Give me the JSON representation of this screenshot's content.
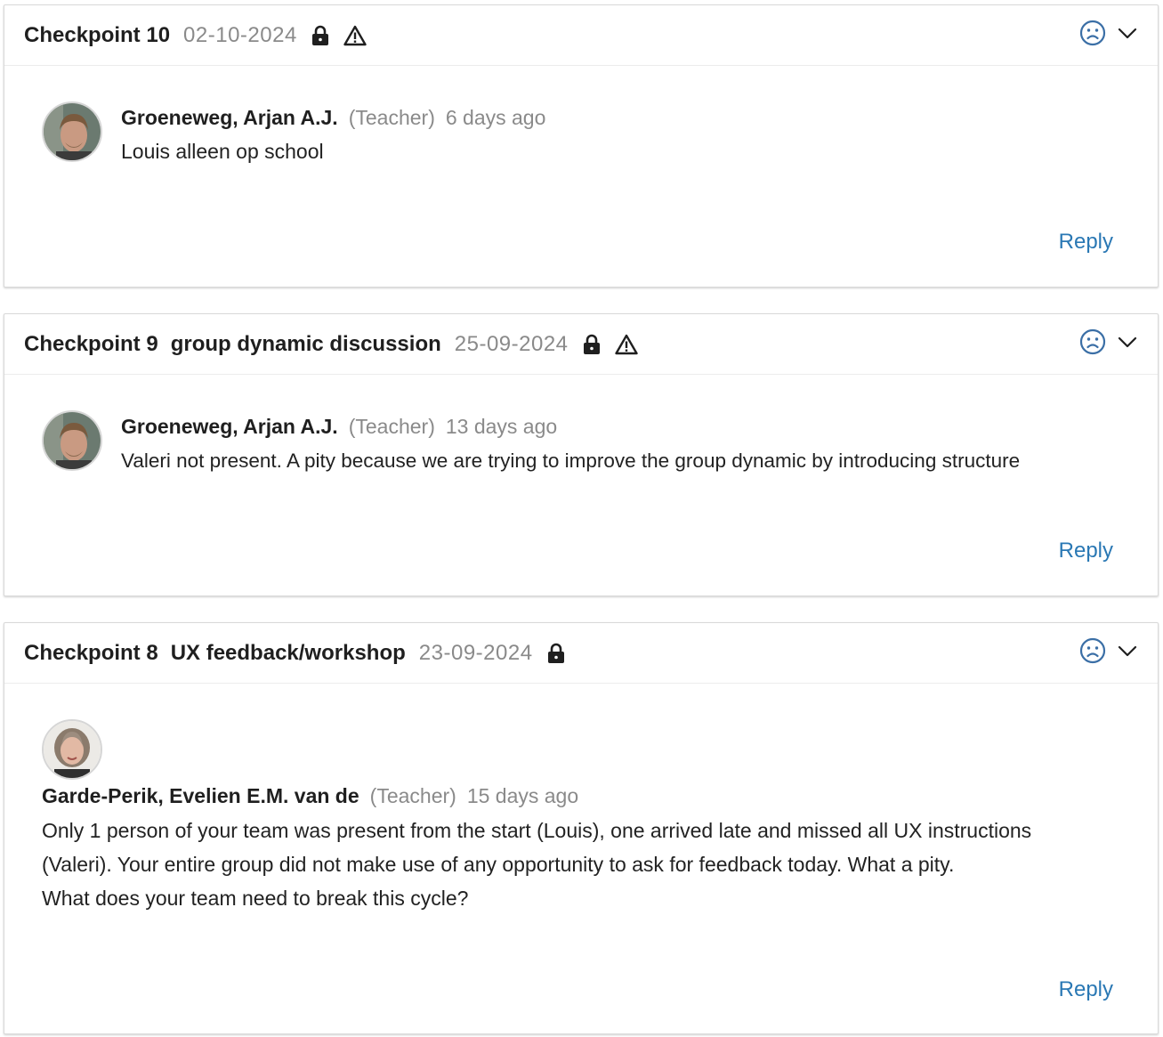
{
  "checkpoints": [
    {
      "title": "Checkpoint 10",
      "subtitle": "",
      "date": "02-10-2024",
      "locked": true,
      "warning": true,
      "comment": {
        "author": "Groeneweg, Arjan A.J.",
        "role": "(Teacher)",
        "time": "6 days ago",
        "message": [
          "Louis alleen op school"
        ]
      },
      "reply_label": "Reply"
    },
    {
      "title": "Checkpoint 9",
      "subtitle": "group dynamic discussion",
      "date": "25-09-2024",
      "locked": true,
      "warning": true,
      "comment": {
        "author": "Groeneweg, Arjan A.J.",
        "role": "(Teacher)",
        "time": "13 days ago",
        "message": [
          "Valeri not present. A pity because we are trying to improve the group dynamic by introducing structure"
        ]
      },
      "reply_label": "Reply"
    },
    {
      "title": "Checkpoint 8",
      "subtitle": "UX feedback/workshop",
      "date": "23-09-2024",
      "locked": true,
      "warning": false,
      "comment": {
        "author": "Garde-Perik, Evelien E.M. van de",
        "role": "(Teacher)",
        "time": "15 days ago",
        "message": [
          "Only 1 person of your team was present from the start (Louis), one arrived late and missed all UX instructions",
          "(Valeri). Your entire group did not make use of any opportunity to ask for feedback today. What a pity.",
          "What does your team need to break this cycle?"
        ]
      },
      "reply_label": "Reply"
    }
  ],
  "icons": {
    "lock": "lock-icon",
    "warning": "warning-icon",
    "mood": "sad-face-icon",
    "collapse": "chevron-down-icon"
  },
  "colors": {
    "accent": "#2a78b4",
    "muted_text": "#8a8a8a",
    "mood_icon": "#3b6fa6"
  }
}
